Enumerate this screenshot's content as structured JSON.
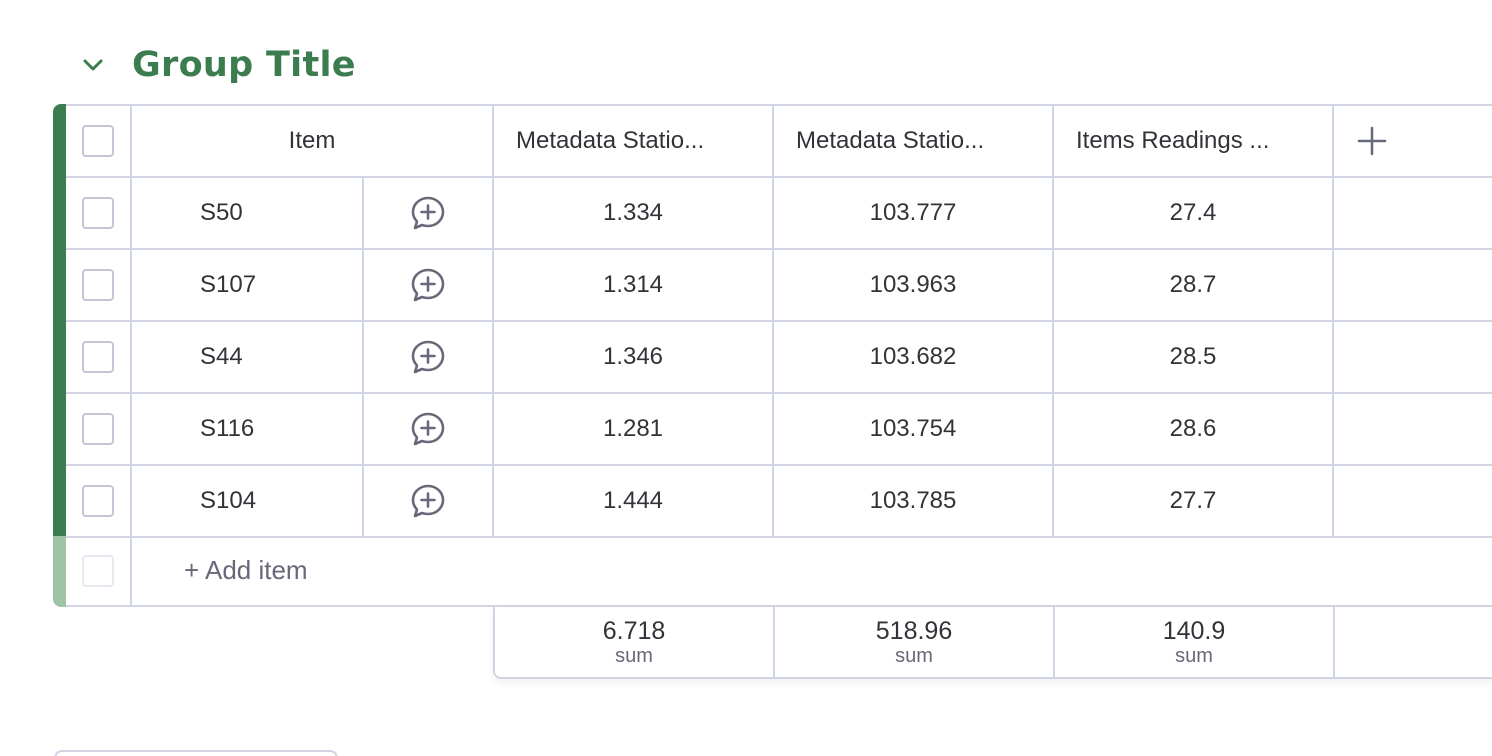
{
  "group": {
    "title": "Group Title",
    "color": "#3b7d4f"
  },
  "columns": {
    "item": "Item",
    "col1": "Metadata Statio...",
    "col2": "Metadata Statio...",
    "col3": "Items Readings ..."
  },
  "rows": [
    {
      "name": "S50",
      "c1": "1.334",
      "c2": "103.777",
      "c3": "27.4"
    },
    {
      "name": "S107",
      "c1": "1.314",
      "c2": "103.963",
      "c3": "28.7"
    },
    {
      "name": "S44",
      "c1": "1.346",
      "c2": "103.682",
      "c3": "28.5"
    },
    {
      "name": "S116",
      "c1": "1.281",
      "c2": "103.754",
      "c3": "28.6"
    },
    {
      "name": "S104",
      "c1": "1.444",
      "c2": "103.785",
      "c3": "27.7"
    }
  ],
  "add_item": "+ Add item",
  "summary": {
    "c1": {
      "value": "6.718",
      "label": "sum"
    },
    "c2": {
      "value": "518.96",
      "label": "sum"
    },
    "c3": {
      "value": "140.9",
      "label": "sum"
    }
  },
  "icons": {
    "collapse": "chevron-down-icon",
    "conversation": "add-update-icon",
    "add_column": "plus-icon"
  }
}
